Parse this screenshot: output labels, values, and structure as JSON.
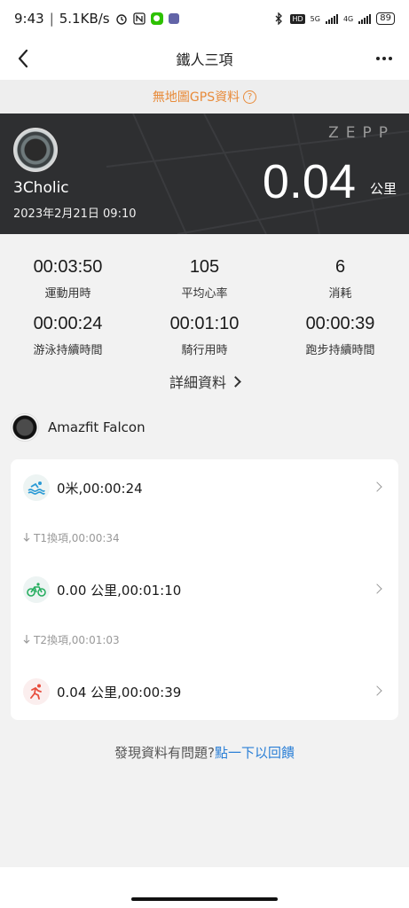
{
  "status_bar": {
    "time": "9:43",
    "speed": "5.1KB/s",
    "battery": "89",
    "net_5g": "5G",
    "net_4g": "4G",
    "hd": "HD"
  },
  "header": {
    "title": "鐵人三項"
  },
  "gps_notice": {
    "text": "無地圖GPS資料",
    "help_glyph": "?"
  },
  "banner": {
    "brand": "ZEPP",
    "username": "3Cholic",
    "date": "2023年2月21日 09:10",
    "distance": "0.04",
    "unit": "公里"
  },
  "stats": [
    {
      "value": "00:03:50",
      "label": "運動用時"
    },
    {
      "value": "105",
      "label": "平均心率"
    },
    {
      "value": "6",
      "label": "消耗"
    },
    {
      "value": "00:00:24",
      "label": "游泳持續時間"
    },
    {
      "value": "00:01:10",
      "label": "騎行用時"
    },
    {
      "value": "00:00:39",
      "label": "跑步持續時間"
    }
  ],
  "details_link": "詳細資料",
  "device": {
    "name": "Amazfit Falcon"
  },
  "segments": [
    {
      "icon": "swim-icon",
      "text": "0米,00:00:24",
      "color": "#2a9bd6"
    },
    {
      "icon": "bike-icon",
      "text": "0.00 公里,00:01:10",
      "color": "#27ae60"
    },
    {
      "icon": "run-icon",
      "text": "0.04 公里,00:00:39",
      "color": "#e74c3c"
    }
  ],
  "transitions": [
    {
      "text": "T1換項,00:00:34"
    },
    {
      "text": "T2換項,00:01:03"
    }
  ],
  "feedback": {
    "question": "發現資料有問題?",
    "link": "點一下以回饋"
  },
  "colors": {
    "accent_orange": "#e88b3a",
    "link_blue": "#2a7fd6",
    "banner_bg": "#2e2f31"
  }
}
